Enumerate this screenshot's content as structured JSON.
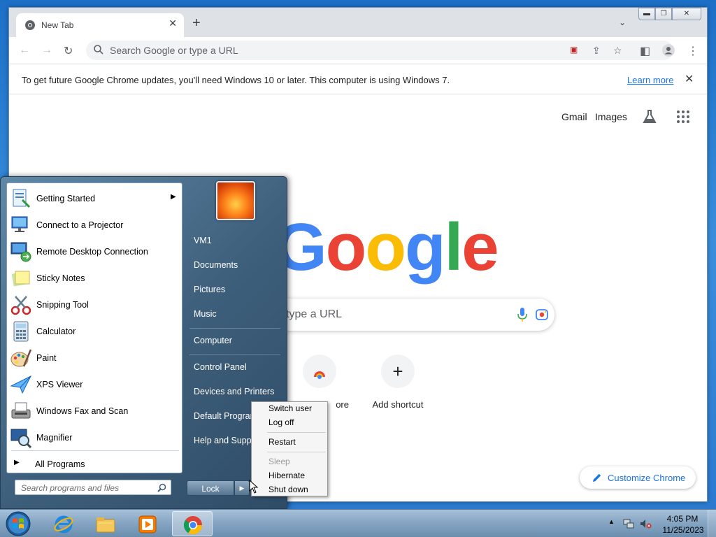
{
  "browser": {
    "tab_title": "New Tab",
    "omnibox_placeholder": "Search Google or type a URL",
    "infobar_message": "To get future Google Chrome updates, you'll need Windows 10 or later. This computer is using Windows 7.",
    "infobar_link": "Learn more",
    "header_links": [
      "Gmail",
      "Images"
    ],
    "ntp_search_placeholder": "type a URL",
    "shortcuts": [
      {
        "label": "ore"
      },
      {
        "label": "Add shortcut"
      }
    ],
    "customize_label": "Customize Chrome",
    "logo_text": "Google",
    "colors": {
      "blue": "#4285f4",
      "red": "#ea4335",
      "yellow": "#fbbc05",
      "green": "#34a853"
    }
  },
  "start_menu": {
    "programs": [
      {
        "label": "Getting Started",
        "icon": "getting-started-icon",
        "has_submenu": true
      },
      {
        "label": "Connect to a Projector",
        "icon": "projector-icon"
      },
      {
        "label": "Remote Desktop Connection",
        "icon": "remote-desktop-icon"
      },
      {
        "label": "Sticky Notes",
        "icon": "sticky-notes-icon"
      },
      {
        "label": "Snipping Tool",
        "icon": "snipping-tool-icon"
      },
      {
        "label": "Calculator",
        "icon": "calculator-icon"
      },
      {
        "label": "Paint",
        "icon": "paint-icon"
      },
      {
        "label": "XPS Viewer",
        "icon": "xps-viewer-icon"
      },
      {
        "label": "Windows Fax and Scan",
        "icon": "fax-scan-icon"
      },
      {
        "label": "Magnifier",
        "icon": "magnifier-icon"
      }
    ],
    "all_programs": "All Programs",
    "search_placeholder": "Search programs and files",
    "right_items": [
      "VM1",
      "Documents",
      "Pictures",
      "Music",
      "Computer",
      "Control Panel",
      "Devices and Printers",
      "Default Programs",
      "Help and Support"
    ],
    "lock_label": "Lock",
    "power_menu": {
      "items": [
        "Switch user",
        "Log off",
        "Restart",
        "Sleep",
        "Hibernate",
        "Shut down"
      ],
      "disabled": [
        "Sleep"
      ]
    }
  },
  "taskbar": {
    "time": "4:05 PM",
    "date": "11/25/2023",
    "apps": [
      "internet-explorer-icon",
      "windows-explorer-icon",
      "media-player-icon",
      "chrome-icon"
    ],
    "active_app": "chrome-icon"
  }
}
